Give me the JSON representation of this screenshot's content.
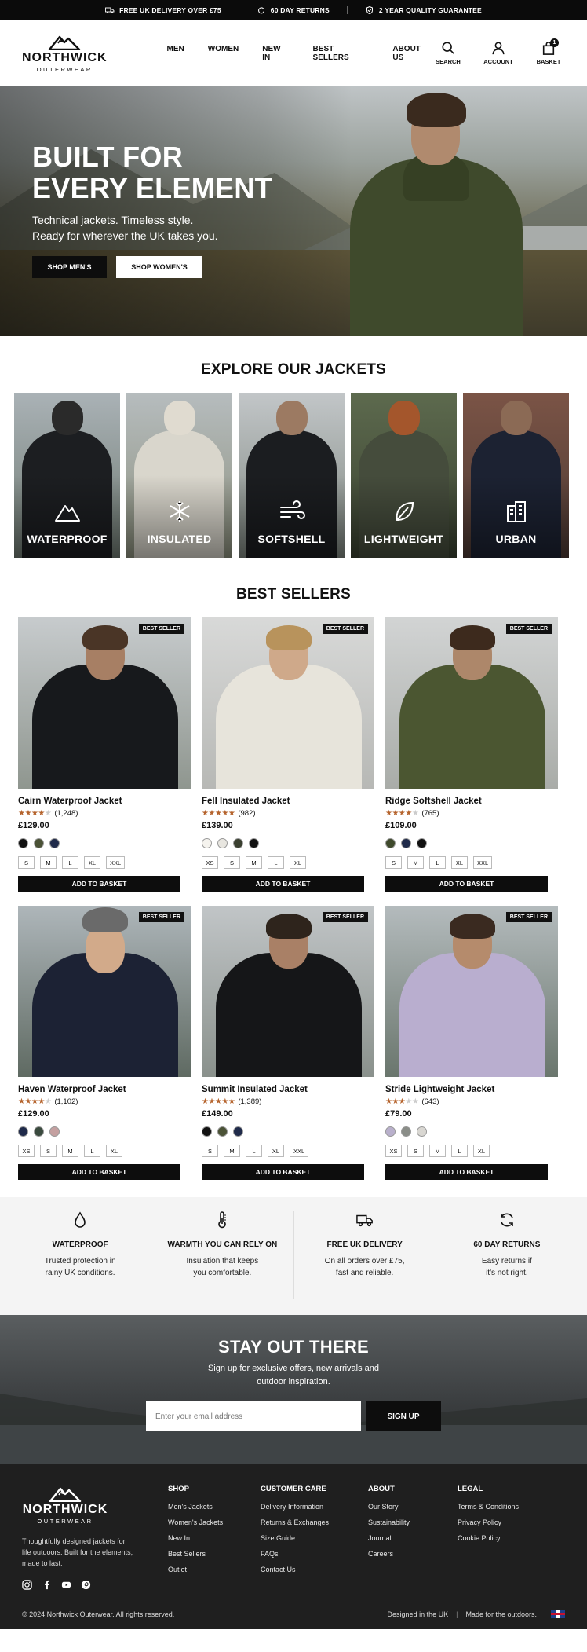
{
  "announcement": {
    "items": [
      "FREE UK DELIVERY OVER £75",
      "60 DAY RETURNS",
      "2 YEAR QUALITY GUARANTEE"
    ]
  },
  "brand": {
    "name": "NORTHWICK",
    "sub": "OUTERWEAR"
  },
  "nav": [
    "MEN",
    "WOMEN",
    "NEW IN",
    "BEST SELLERS",
    "ABOUT US"
  ],
  "header_icons": {
    "search": "SEARCH",
    "account": "ACCOUNT",
    "basket": "BASKET",
    "basket_count": "1"
  },
  "hero": {
    "title_line1": "BUILT FOR",
    "title_line2": "EVERY ELEMENT",
    "subtitle_line1": "Technical jackets. Timeless style.",
    "subtitle_line2": "Ready for wherever the UK takes you.",
    "btn_men": "SHOP MEN'S",
    "btn_women": "SHOP WOMEN'S"
  },
  "explore": {
    "title": "EXPLORE OUR JACKETS",
    "categories": [
      {
        "label": "WATERPROOF",
        "icon": "mountain-icon"
      },
      {
        "label": "INSULATED",
        "icon": "snowflake-icon"
      },
      {
        "label": "SOFTSHELL",
        "icon": "wind-icon"
      },
      {
        "label": "LIGHTWEIGHT",
        "icon": "leaf-icon"
      },
      {
        "label": "URBAN",
        "icon": "buildings-icon"
      }
    ]
  },
  "best_sellers": {
    "title": "BEST SELLERS",
    "badge": "BEST SELLER",
    "add_label": "ADD TO BASKET",
    "products": [
      {
        "name": "Cairn Waterproof Jacket",
        "rating": 4,
        "reviews": "(1,248)",
        "price": "£129.00",
        "colors": [
          "#111111",
          "#4b5236",
          "#1f2a4a"
        ],
        "sizes": [
          "S",
          "M",
          "L",
          "XL",
          "XXL"
        ]
      },
      {
        "name": "Fell Insulated Jacket",
        "rating": 5,
        "reviews": "(982)",
        "price": "£139.00",
        "colors": [
          "#f5f3ee",
          "#e8e6e0",
          "#3a4030",
          "#111111"
        ],
        "sizes": [
          "XS",
          "S",
          "M",
          "L",
          "XL"
        ]
      },
      {
        "name": "Ridge Softshell Jacket",
        "rating": 4,
        "reviews": "(765)",
        "price": "£109.00",
        "colors": [
          "#3f4a2c",
          "#1f2a4a",
          "#111111"
        ],
        "sizes": [
          "S",
          "M",
          "L",
          "XL",
          "XXL"
        ]
      },
      {
        "name": "Haven Waterproof Jacket",
        "rating": 4,
        "reviews": "(1,102)",
        "price": "£129.00",
        "colors": [
          "#1f2a4a",
          "#3a4a3e",
          "#c4a0a0"
        ],
        "sizes": [
          "XS",
          "S",
          "M",
          "L",
          "XL"
        ]
      },
      {
        "name": "Summit Insulated Jacket",
        "rating": 5,
        "reviews": "(1,389)",
        "price": "£149.00",
        "colors": [
          "#111111",
          "#4b5236",
          "#1f2a4a"
        ],
        "sizes": [
          "S",
          "M",
          "L",
          "XL",
          "XXL"
        ]
      },
      {
        "name": "Stride Lightweight Jacket",
        "rating": 3,
        "reviews": "(643)",
        "price": "£79.00",
        "colors": [
          "#b9b0cc",
          "#8a8d88",
          "#d9d7d2"
        ],
        "sizes": [
          "XS",
          "S",
          "M",
          "L",
          "XL"
        ]
      }
    ]
  },
  "features": [
    {
      "title": "WATERPROOF",
      "line1": "Trusted protection in",
      "line2": "rainy UK conditions.",
      "icon": "droplet-icon"
    },
    {
      "title": "WARMTH YOU CAN RELY ON",
      "line1": "Insulation that keeps",
      "line2": "you comfortable.",
      "icon": "thermometer-icon"
    },
    {
      "title": "FREE UK DELIVERY",
      "line1": "On all orders over £75,",
      "line2": "fast and reliable.",
      "icon": "truck-icon"
    },
    {
      "title": "60 DAY RETURNS",
      "line1": "Easy returns if",
      "line2": "it's not right.",
      "icon": "refresh-icon"
    }
  ],
  "newsletter": {
    "title": "STAY OUT THERE",
    "line1": "Sign up for exclusive offers, new arrivals and",
    "line2": "outdoor inspiration.",
    "placeholder": "Enter your email address",
    "button": "SIGN UP"
  },
  "footer": {
    "about_line1": "Thoughtfully designed jackets for",
    "about_line2": "life outdoors. Built for the elements,",
    "about_line3": "made to last.",
    "columns": [
      {
        "title": "SHOP",
        "links": [
          "Men's Jackets",
          "Women's Jackets",
          "New In",
          "Best Sellers",
          "Outlet"
        ]
      },
      {
        "title": "CUSTOMER CARE",
        "links": [
          "Delivery Information",
          "Returns & Exchanges",
          "Size Guide",
          "FAQs",
          "Contact Us"
        ]
      },
      {
        "title": "ABOUT",
        "links": [
          "Our Story",
          "Sustainability",
          "Journal",
          "Careers"
        ]
      },
      {
        "title": "LEGAL",
        "links": [
          "Terms & Conditions",
          "Privacy Policy",
          "Cookie Policy"
        ]
      }
    ],
    "copyright": "© 2024 Northwick Outerwear. All rights reserved.",
    "designed": "Designed in the UK",
    "made": "Made for the outdoors."
  }
}
